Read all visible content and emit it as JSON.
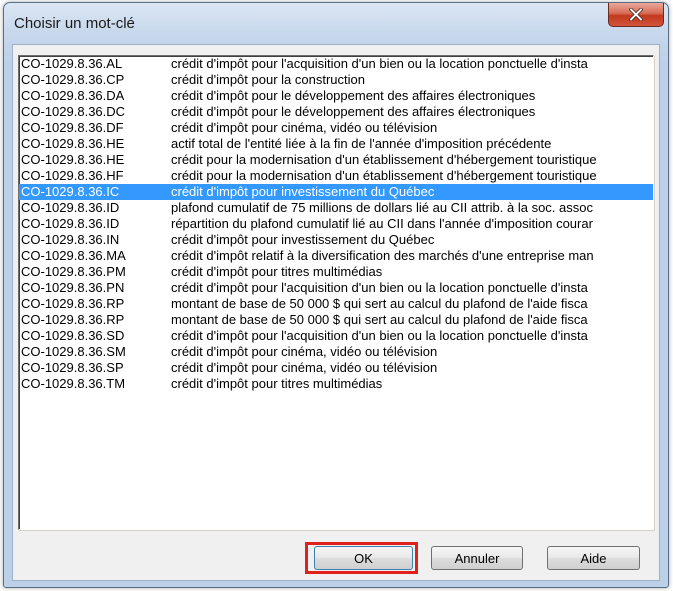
{
  "window": {
    "title": "Choisir un mot-clé"
  },
  "list": {
    "selected_index": 8,
    "items": [
      {
        "code": "CO-1029.8.36.AL",
        "desc": "crédit d'impôt pour l'acquisition d'un bien ou la location ponctuelle d'insta"
      },
      {
        "code": "CO-1029.8.36.CP",
        "desc": "crédit d'impôt pour la construction"
      },
      {
        "code": "CO-1029.8.36.DA",
        "desc": "crédit d'impôt pour le développement des affaires électroniques"
      },
      {
        "code": "CO-1029.8.36.DC",
        "desc": "crédit d'impôt pour le développement des affaires électroniques"
      },
      {
        "code": "CO-1029.8.36.DF",
        "desc": "crédit d'impôt pour cinéma, vidéo ou télévision"
      },
      {
        "code": "CO-1029.8.36.HE",
        "desc": "actif total de l'entité liée à la fin de l'année d'imposition précédente"
      },
      {
        "code": "CO-1029.8.36.HE",
        "desc": "crédit pour la modernisation d'un établissement d'hébergement touristique"
      },
      {
        "code": "CO-1029.8.36.HF",
        "desc": "crédit pour la modernisation d'un établissement d'hébergement touristique"
      },
      {
        "code": "CO-1029.8.36.IC",
        "desc": "crédit d'impôt pour investissement du Québec"
      },
      {
        "code": "CO-1029.8.36.ID",
        "desc": "plafond cumulatif de 75 millions de dollars lié au CII attrib. à la soc. assoc"
      },
      {
        "code": "CO-1029.8.36.ID",
        "desc": "répartition du plafond cumulatif lié au CII dans l'année d'imposition courar"
      },
      {
        "code": "CO-1029.8.36.IN",
        "desc": "crédit d'impôt pour investissement du Québec"
      },
      {
        "code": "CO-1029.8.36.MA",
        "desc": "crédit d'impôt relatif à la diversification des marchés d'une entreprise man"
      },
      {
        "code": "CO-1029.8.36.PM",
        "desc": "crédit d'impôt pour titres multimédias"
      },
      {
        "code": "CO-1029.8.36.PN",
        "desc": "crédit d'impôt pour l'acquisition d'un bien ou la location ponctuelle d'insta"
      },
      {
        "code": "CO-1029.8.36.RP",
        "desc": "montant de base de 50 000 $ qui sert au calcul du plafond de l'aide fisca"
      },
      {
        "code": "CO-1029.8.36.RP",
        "desc": "montant de base de 50 000 $ qui sert au calcul du plafond de l'aide fisca"
      },
      {
        "code": "CO-1029.8.36.SD",
        "desc": "crédit d'impôt pour l'acquisition d'un bien ou la location ponctuelle d'insta"
      },
      {
        "code": "CO-1029.8.36.SM",
        "desc": "crédit d'impôt pour cinéma, vidéo ou télévision"
      },
      {
        "code": "CO-1029.8.36.SP",
        "desc": "crédit d'impôt pour cinéma, vidéo ou télévision"
      },
      {
        "code": "CO-1029.8.36.TM",
        "desc": "crédit d'impôt pour titres multimédias"
      }
    ]
  },
  "buttons": {
    "ok": "OK",
    "cancel": "Annuler",
    "help": "Aide"
  },
  "icons": {
    "close": "close-icon"
  },
  "colors": {
    "selection": "#3399ff",
    "highlight_box": "#e0201c",
    "close_button": "#c2391e"
  }
}
